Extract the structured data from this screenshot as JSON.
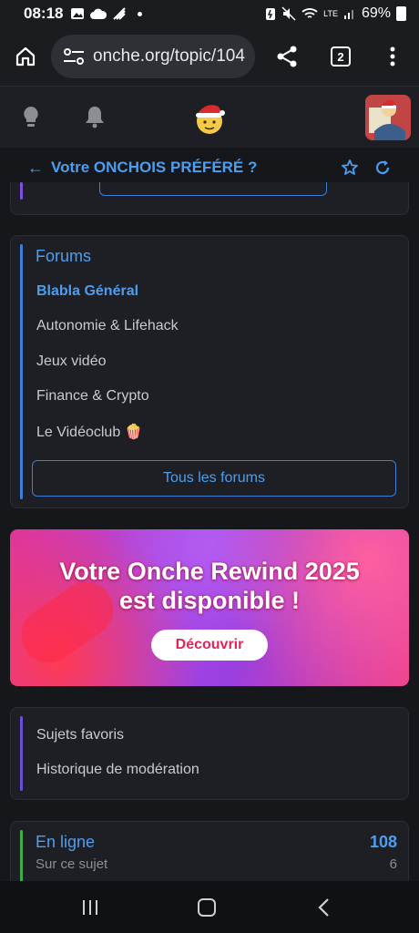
{
  "status_bar": {
    "time": "08:18",
    "battery": "69%",
    "network": "LTE"
  },
  "browser": {
    "url": "onche.org/topic/104",
    "tab_count": "2"
  },
  "topic": {
    "title": "Votre ONCHOIS PRÉFÉRÉ ?"
  },
  "forums": {
    "title": "Forums",
    "items": [
      {
        "label": "Blabla Général",
        "active": true
      },
      {
        "label": "Autonomie & Lifehack",
        "active": false
      },
      {
        "label": "Jeux vidéo",
        "active": false
      },
      {
        "label": "Finance & Crypto",
        "active": false
      },
      {
        "label": "Le Vidéoclub 🍿",
        "active": false
      }
    ],
    "all_button": "Tous les forums"
  },
  "banner": {
    "line1": "Votre Onche Rewind 2025",
    "line2": "est disponible !",
    "cta": "Découvrir"
  },
  "links": {
    "items": [
      "Sujets favoris",
      "Historique de modération"
    ]
  },
  "online": {
    "title": "En ligne",
    "count": "108",
    "sub_label": "Sur ce sujet",
    "sub_count": "6"
  },
  "colors": {
    "accent": "#4c9ef0",
    "background": "#16171b",
    "card": "#1e1f24",
    "online_bar": "#3fae4a",
    "forum_bar": "#3d7ed8",
    "links_bar": "#6b4fd6"
  },
  "icons": [
    "home-icon",
    "site-settings-icon",
    "share-icon",
    "tabs-icon",
    "more-vert-icon",
    "lightbulb-icon",
    "bell-icon",
    "santa-smiley-logo",
    "back-arrow-icon",
    "star-icon",
    "refresh-icon",
    "recents-icon",
    "home-nav-icon",
    "back-nav-icon"
  ]
}
